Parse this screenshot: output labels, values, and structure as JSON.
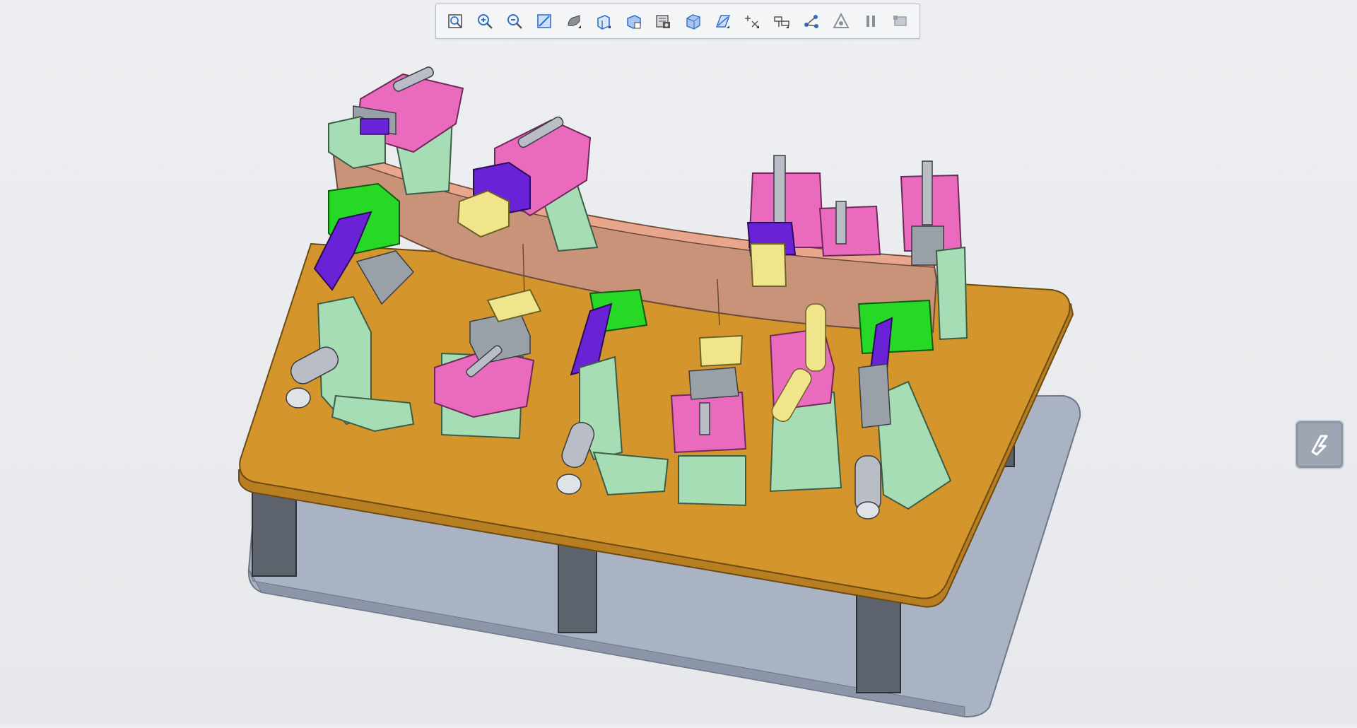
{
  "app": {
    "accent": "#2f6fd0"
  },
  "toolbar": {
    "items": [
      {
        "icon": "refit-icon"
      },
      {
        "icon": "zoom-in-icon"
      },
      {
        "icon": "zoom-out-icon"
      },
      {
        "icon": "repaint-icon"
      },
      {
        "icon": "display-style-icon"
      },
      {
        "icon": "saved-orientations-icon"
      },
      {
        "icon": "view-manager-icon"
      },
      {
        "icon": "perspective-icon"
      },
      {
        "icon": "section-icon"
      },
      {
        "icon": "datum-display-icon"
      },
      {
        "icon": "annotation-display-icon"
      },
      {
        "icon": "spin-center-icon"
      },
      {
        "icon": "network-icon"
      },
      {
        "icon": "simulation-icon"
      },
      {
        "icon": "pause-icon"
      },
      {
        "icon": "stop-icon"
      }
    ]
  },
  "scene": {
    "colors": {
      "table_top": "#d3952c",
      "table_edge": "#b87e22",
      "base_plate": "#a9b3c3",
      "legs": "#5d636c",
      "part": "#c9937a",
      "support": "#a6ddb4",
      "clamp_plate": "#ea6bbd",
      "block_yellow": "#f0e58a",
      "block_green": "#27d827",
      "purple": "#6a22d6",
      "gray_metal": "#9aa0a8",
      "cylinder": "#b9bec6"
    }
  },
  "side_button": {
    "icon": "lightning-icon"
  }
}
